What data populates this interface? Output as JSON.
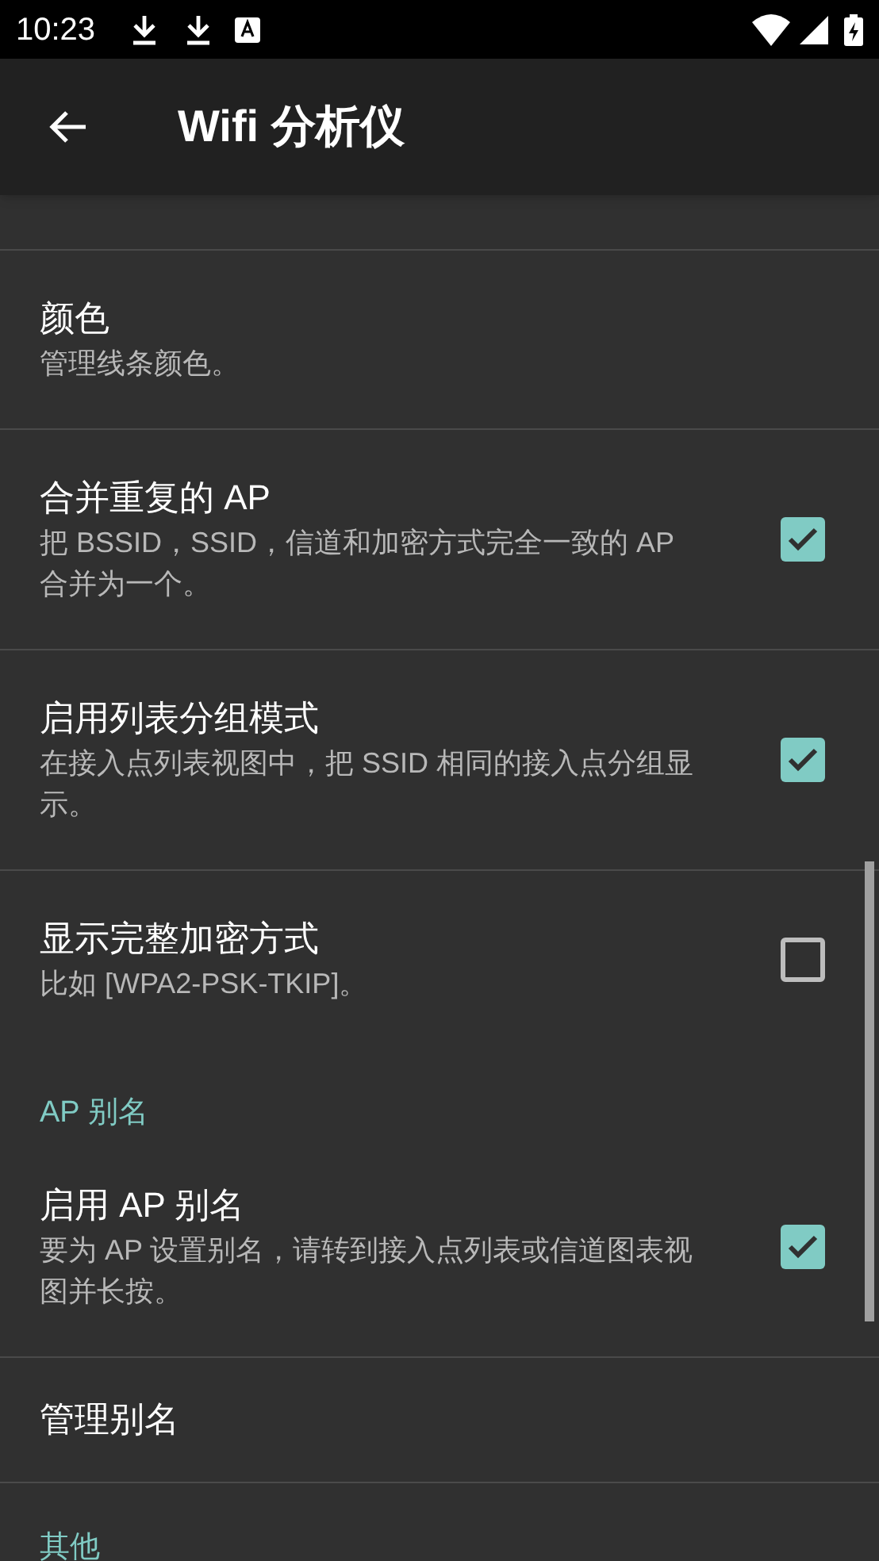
{
  "status_bar": {
    "time": "10:23"
  },
  "toolbar": {
    "title": "Wifi 分析仪"
  },
  "preferences": [
    {
      "kind": "partial"
    },
    {
      "kind": "setting",
      "title": "颜色",
      "summary": "管理线条颜色。"
    },
    {
      "kind": "setting",
      "title": "合并重复的 AP",
      "summary": "把 BSSID，SSID，信道和加密方式完全一致的 AP 合并为一个。",
      "checked": true
    },
    {
      "kind": "setting",
      "title": "启用列表分组模式",
      "summary": "在接入点列表视图中，把 SSID 相同的接入点分组显示。",
      "checked": true
    },
    {
      "kind": "setting",
      "title": "显示完整加密方式",
      "summary": "比如 [WPA2-PSK-TKIP]。",
      "checked": false,
      "divider": false
    },
    {
      "kind": "category",
      "title": "AP 别名"
    },
    {
      "kind": "setting",
      "title": "启用 AP 别名",
      "summary": "要为 AP 设置别名，请转到接入点列表或信道图表视图并长按。",
      "checked": true
    },
    {
      "kind": "setting",
      "title": "管理别名"
    },
    {
      "kind": "category",
      "title": "其他"
    }
  ]
}
